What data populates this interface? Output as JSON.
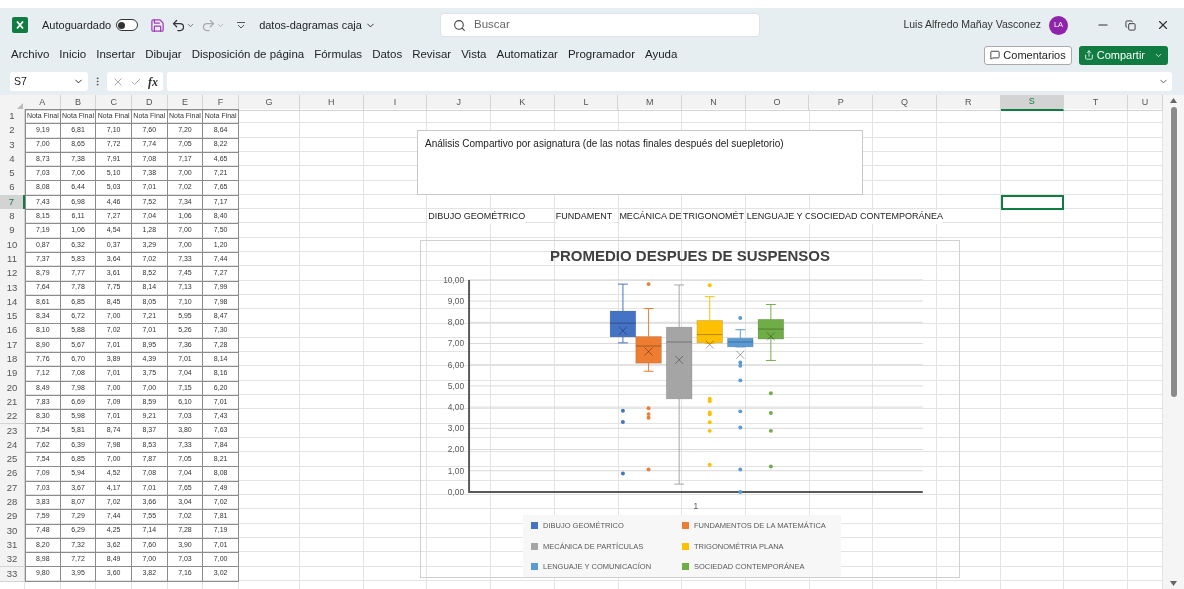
{
  "title_bar": {
    "autosave_label": "Autoguardado",
    "autosave_on": false,
    "redo_disabled": true,
    "file_name": "datos-dagramas caja",
    "search_placeholder": "Buscar",
    "user_name": "Luis Alfredo Mañay Vasconez",
    "avatar_initials": "LA"
  },
  "menu": [
    "Archivo",
    "Inicio",
    "Insertar",
    "Dibujar",
    "Disposición de página",
    "Fórmulas",
    "Datos",
    "Revisar",
    "Vista",
    "Automatizar",
    "Programador",
    "Ayuda"
  ],
  "comments_button": "Comentarios",
  "share_button": "Compartir",
  "formula_bar": {
    "name_box": "S7",
    "fx_label": "fx"
  },
  "sheet": {
    "columns": [
      {
        "label": "A",
        "selected": false
      },
      {
        "label": "B",
        "selected": false
      },
      {
        "label": "C",
        "selected": false
      },
      {
        "label": "D",
        "selected": false
      },
      {
        "label": "E",
        "selected": false
      },
      {
        "label": "F",
        "selected": false
      },
      {
        "label": "G",
        "selected": false
      },
      {
        "label": "H",
        "selected": false
      },
      {
        "label": "I",
        "selected": false
      },
      {
        "label": "J",
        "selected": false
      },
      {
        "label": "K",
        "selected": false
      },
      {
        "label": "L",
        "selected": false
      },
      {
        "label": "M",
        "selected": false
      },
      {
        "label": "N",
        "selected": false
      },
      {
        "label": "O",
        "selected": false
      },
      {
        "label": "P",
        "selected": false
      },
      {
        "label": "Q",
        "selected": false
      },
      {
        "label": "R",
        "selected": false
      },
      {
        "label": "S",
        "selected": true
      },
      {
        "label": "T",
        "selected": false
      },
      {
        "label": "U",
        "selected": false
      }
    ],
    "rows": [
      {
        "label": "1",
        "selected": false,
        "cells": [
          "Nota Final",
          "Nota Final",
          "Nota Final",
          "Nota Final",
          "Nota Final",
          "Nota Final"
        ]
      },
      {
        "label": "2",
        "selected": false,
        "cells": [
          "9,19",
          "6,81",
          "7,10",
          "7,60",
          "7,20",
          "8,64"
        ]
      },
      {
        "label": "3",
        "selected": false,
        "cells": [
          "7,00",
          "8,65",
          "7,72",
          "7,74",
          "7,05",
          "8,22"
        ]
      },
      {
        "label": "4",
        "selected": false,
        "cells": [
          "8,73",
          "7,38",
          "7,91",
          "7,08",
          "7,17",
          "4,65"
        ]
      },
      {
        "label": "5",
        "selected": false,
        "cells": [
          "7,03",
          "7,06",
          "5,10",
          "7,38",
          "7,00",
          "7,21"
        ]
      },
      {
        "label": "6",
        "selected": false,
        "cells": [
          "8,08",
          "6,44",
          "5,03",
          "7,01",
          "7,02",
          "7,65"
        ]
      },
      {
        "label": "7",
        "selected": true,
        "cells": [
          "7,43",
          "6,98",
          "4,46",
          "7,52",
          "7,34",
          "7,17"
        ]
      },
      {
        "label": "8",
        "selected": false,
        "cells": [
          "8,15",
          "6,11",
          "7,27",
          "7,04",
          "1,06",
          "8,40"
        ]
      },
      {
        "label": "9",
        "selected": false,
        "cells": [
          "7,19",
          "1,06",
          "4,54",
          "1,28",
          "7,00",
          "7,50"
        ]
      },
      {
        "label": "10",
        "selected": false,
        "cells": [
          "0,87",
          "6,32",
          "0,37",
          "3,29",
          "7,00",
          "1,20"
        ]
      },
      {
        "label": "11",
        "selected": false,
        "cells": [
          "7,37",
          "5,83",
          "3,64",
          "7,02",
          "7,33",
          "7,44"
        ]
      },
      {
        "label": "12",
        "selected": false,
        "cells": [
          "8,79",
          "7,77",
          "3,61",
          "8,52",
          "7,45",
          "7,27"
        ]
      },
      {
        "label": "13",
        "selected": false,
        "cells": [
          "7,64",
          "7,78",
          "7,75",
          "8,14",
          "7,13",
          "7,99"
        ]
      },
      {
        "label": "14",
        "selected": false,
        "cells": [
          "8,61",
          "6,85",
          "8,45",
          "8,05",
          "7,10",
          "7,98"
        ]
      },
      {
        "label": "15",
        "selected": false,
        "cells": [
          "8,34",
          "6,72",
          "7,00",
          "7,21",
          "5,95",
          "8,47"
        ]
      },
      {
        "label": "16",
        "selected": false,
        "cells": [
          "8,10",
          "5,88",
          "7,02",
          "7,01",
          "5,26",
          "7,30"
        ]
      },
      {
        "label": "17",
        "selected": false,
        "cells": [
          "8,90",
          "5,67",
          "7,01",
          "8,95",
          "7,36",
          "7,28"
        ]
      },
      {
        "label": "18",
        "selected": false,
        "cells": [
          "7,76",
          "6,70",
          "3,89",
          "4,39",
          "7,01",
          "8,14"
        ]
      },
      {
        "label": "19",
        "selected": false,
        "cells": [
          "7,12",
          "7,08",
          "7,01",
          "3,75",
          "7,04",
          "8,16"
        ]
      },
      {
        "label": "20",
        "selected": false,
        "cells": [
          "8,49",
          "7,98",
          "7,00",
          "7,00",
          "7,15",
          "6,20"
        ]
      },
      {
        "label": "21",
        "selected": false,
        "cells": [
          "7,83",
          "6,69",
          "7,09",
          "8,59",
          "6,10",
          "7,01"
        ]
      },
      {
        "label": "22",
        "selected": false,
        "cells": [
          "8,30",
          "5,98",
          "7,01",
          "9,21",
          "7,03",
          "7,43"
        ]
      },
      {
        "label": "23",
        "selected": false,
        "cells": [
          "7,54",
          "5,81",
          "8,74",
          "8,37",
          "3,80",
          "7,63"
        ]
      },
      {
        "label": "24",
        "selected": false,
        "cells": [
          "7,62",
          "6,39",
          "7,98",
          "8,53",
          "7,33",
          "7,84"
        ]
      },
      {
        "label": "25",
        "selected": false,
        "cells": [
          "7,54",
          "6,85",
          "7,00",
          "7,87",
          "7,05",
          "8,21"
        ]
      },
      {
        "label": "26",
        "selected": false,
        "cells": [
          "7,09",
          "5,94",
          "4,52",
          "7,08",
          "7,04",
          "8,08"
        ]
      },
      {
        "label": "27",
        "selected": false,
        "cells": [
          "7,03",
          "3,67",
          "4,17",
          "7,01",
          "7,65",
          "7,49"
        ]
      },
      {
        "label": "28",
        "selected": false,
        "cells": [
          "3,83",
          "8,07",
          "7,02",
          "3,66",
          "3,04",
          "7,02"
        ]
      },
      {
        "label": "29",
        "selected": false,
        "cells": [
          "7,59",
          "7,29",
          "7,44",
          "7,55",
          "7,02",
          "7,81"
        ]
      },
      {
        "label": "30",
        "selected": false,
        "cells": [
          "7,48",
          "6,29",
          "4,25",
          "7,14",
          "7,28",
          "7,19"
        ]
      },
      {
        "label": "31",
        "selected": false,
        "cells": [
          "8,20",
          "7,32",
          "3,62",
          "7,60",
          "3,90",
          "7,01"
        ]
      },
      {
        "label": "32",
        "selected": false,
        "cells": [
          "8,98",
          "7,72",
          "8,49",
          "7,00",
          "7,03",
          "7,00"
        ]
      },
      {
        "label": "33",
        "selected": false,
        "cells": [
          "9,80",
          "3,95",
          "3,60",
          "3,82",
          "7,16",
          "3,02"
        ]
      }
    ],
    "row_8_labels": [
      "DIBUJO GEOMÉTRICO",
      "FUNDAMENT",
      "MECÁNICA DE",
      "TRIGONOMÉT",
      "LENGUAJE Y C",
      "SOCIEDAD CONTEMPORÁNEA"
    ]
  },
  "text_box": "Análisis Compartivo por asignatura (de las notas finales después del suepletorio)",
  "chart": {
    "kind": "box-plot",
    "title": "PROMEDIO DESPUES DE SUSPENSOS",
    "x_label": "1",
    "y_tick_labels": [
      "10,00",
      "9,00",
      "8,00",
      "7,00",
      "6,00",
      "5,00",
      "4,00",
      "3,00",
      "2,00",
      "1,00",
      "0,00"
    ],
    "legend": [
      {
        "name": "DIBUJO GEOMÉTRICO",
        "color": "#4472c4"
      },
      {
        "name": "FUNDAMENTOS DE LA MATEMÁTICA",
        "color": "#ed7d31"
      },
      {
        "name": "MECÁNICA DE PARTÍCULAS",
        "color": "#a5a5a5"
      },
      {
        "name": "TRIGONOMÉTRIA PLANA",
        "color": "#ffc000"
      },
      {
        "name": "LENGUAJE Y COMUNICACÍON",
        "color": "#5b9bd5"
      },
      {
        "name": "SOCIEDAD CONTEMPORÁNEA",
        "color": "#70ad47"
      }
    ]
  }
}
